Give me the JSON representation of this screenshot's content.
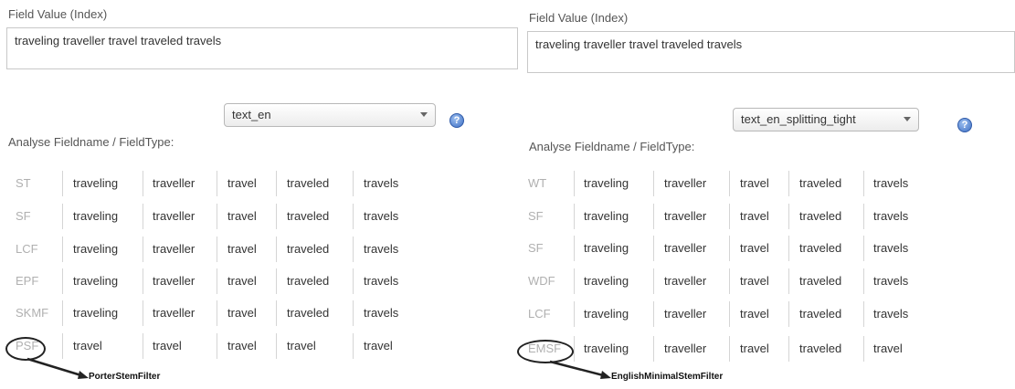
{
  "left": {
    "field_label": "Field Value (Index)",
    "field_value": "traveling traveller travel traveled travels",
    "analyse_label": "Analyse Fieldname / FieldType:",
    "selected_type": "text_en",
    "help_icon": "?",
    "rows": [
      {
        "label": "ST",
        "tokens": [
          "traveling",
          "traveller",
          "travel",
          "traveled",
          "travels"
        ]
      },
      {
        "label": "SF",
        "tokens": [
          "traveling",
          "traveller",
          "travel",
          "traveled",
          "travels"
        ]
      },
      {
        "label": "LCF",
        "tokens": [
          "traveling",
          "traveller",
          "travel",
          "traveled",
          "travels"
        ]
      },
      {
        "label": "EPF",
        "tokens": [
          "traveling",
          "traveller",
          "travel",
          "traveled",
          "travels"
        ]
      },
      {
        "label": "SKMF",
        "tokens": [
          "traveling",
          "traveller",
          "travel",
          "traveled",
          "travels"
        ]
      },
      {
        "label": "PSF",
        "tokens": [
          "travel",
          "travel",
          "travel",
          "travel",
          "travel"
        ]
      }
    ],
    "callout": "PorterStemFilter"
  },
  "right": {
    "field_label": "Field Value (Index)",
    "field_value": "traveling traveller travel traveled travels",
    "analyse_label": "Analyse Fieldname / FieldType:",
    "selected_type": "text_en_splitting_tight",
    "help_icon": "?",
    "rows": [
      {
        "label": "WT",
        "tokens": [
          "traveling",
          "traveller",
          "travel",
          "traveled",
          "travels"
        ]
      },
      {
        "label": "SF",
        "tokens": [
          "traveling",
          "traveller",
          "travel",
          "traveled",
          "travels"
        ]
      },
      {
        "label": "SF",
        "tokens": [
          "traveling",
          "traveller",
          "travel",
          "traveled",
          "travels"
        ]
      },
      {
        "label": "WDF",
        "tokens": [
          "traveling",
          "traveller",
          "travel",
          "traveled",
          "travels"
        ]
      },
      {
        "label": "LCF",
        "tokens": [
          "traveling",
          "traveller",
          "travel",
          "traveled",
          "travels"
        ]
      },
      {
        "label": "EMSF",
        "tokens": [
          "traveling",
          "traveller",
          "travel",
          "traveled",
          "travel"
        ]
      }
    ],
    "callout": "EnglishMinimalStemFilter"
  }
}
